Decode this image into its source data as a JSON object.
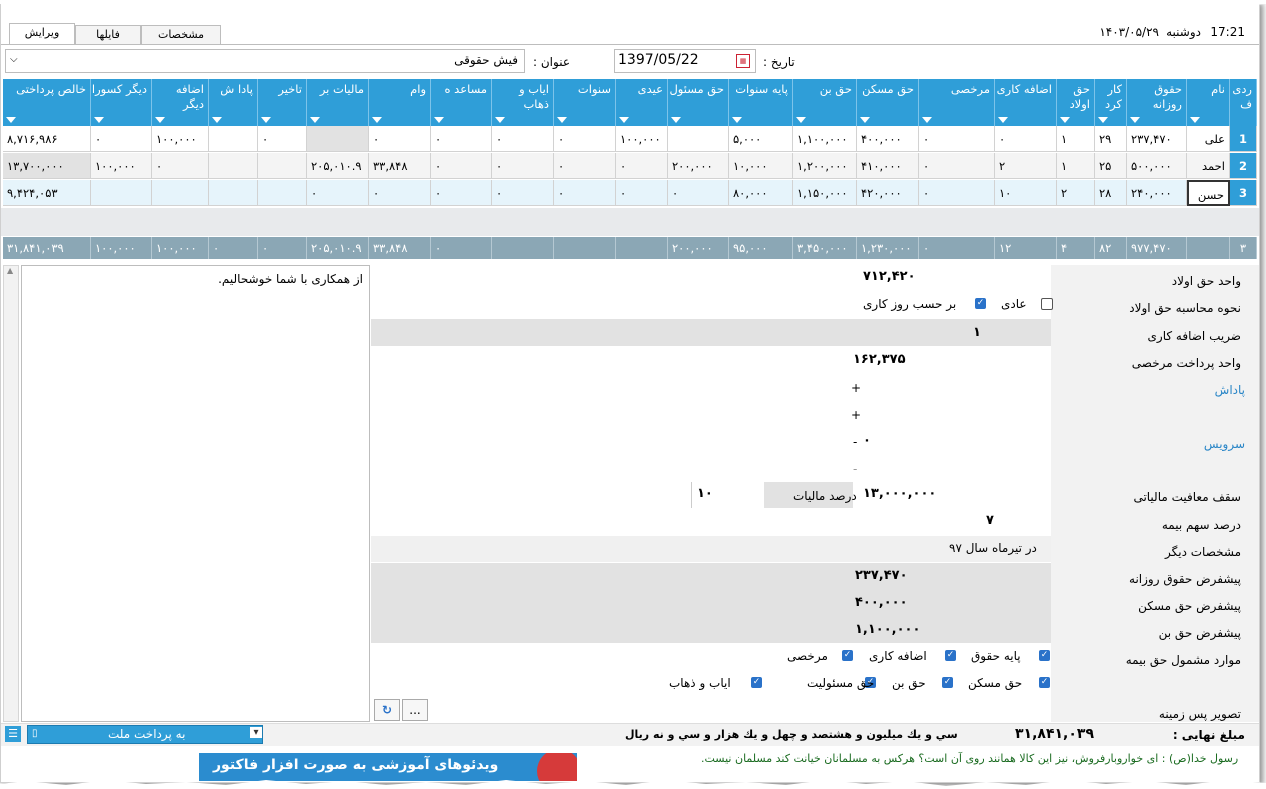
{
  "status": {
    "time": "17:21",
    "day": "دوشنبه",
    "date": "۱۴۰۳/۰۵/۲۹"
  },
  "tabs": [
    "ویرایش",
    "فایلها",
    "مشخصات"
  ],
  "form": {
    "date_label": "تاریخ :",
    "date_value": "1397/05/22",
    "title_label": "عنوان :",
    "title_value": "فیش حقوقی"
  },
  "table": {
    "columns": [
      "ردی ف",
      "نام",
      "حقوق روزانه",
      "کار کرد",
      "حق اولاد",
      "اضافه کاری",
      "مرخصی",
      "حق مسکن",
      "حق بن",
      "پایه سنوات",
      "حق مسئول",
      "عیدی",
      "سنوات",
      "ایاب و ذهاب",
      "مساعد ه",
      "وام",
      "مالیات بر",
      "تاخیر",
      "پادا ش",
      "اضافه دیگر",
      "دیگر کسورا",
      "خالص پرداختی"
    ],
    "rows": [
      [
        "1",
        "علی",
        "۲۳۷,۴۷۰",
        "۲۹",
        "۱",
        "۰",
        "۰",
        "۴۰۰,۰۰۰",
        "۱,۱۰۰,۰۰۰",
        "۵,۰۰۰",
        "",
        "۱۰۰,۰۰۰",
        "۰",
        "۰",
        "۰",
        "۰",
        "",
        "۰",
        "",
        "۱۰۰,۰۰۰",
        "۰",
        "۸,۷۱۶,۹۸۶"
      ],
      [
        "2",
        "احمد",
        "۵۰۰,۰۰۰",
        "۲۵",
        "۱",
        "۲",
        "۰",
        "۴۱۰,۰۰۰",
        "۱,۲۰۰,۰۰۰",
        "۱۰,۰۰۰",
        "۲۰۰,۰۰۰",
        "۰",
        "۰",
        "۰",
        "۰",
        "۳۳,۸۴۸",
        "۲۰۵,۰۱۰.۹",
        "",
        "",
        "۰",
        "۱۰۰,۰۰۰",
        "۱۳,۷۰۰,۰۰۰"
      ],
      [
        "3",
        "حسن",
        "۲۴۰,۰۰۰",
        "۲۸",
        "۲",
        "۱۰",
        "۰",
        "۴۲۰,۰۰۰",
        "۱,۱۵۰,۰۰۰",
        "۸۰,۰۰۰",
        "۰",
        "۰",
        "۰",
        "۰",
        "۰",
        "۰",
        "۰",
        "",
        "",
        "",
        "",
        "۹,۴۲۴,۰۵۳"
      ]
    ],
    "totals": [
      "۳",
      "",
      "۹۷۷,۴۷۰",
      "۸۲",
      "۴",
      "۱۲",
      "۰",
      "۱,۲۳۰,۰۰۰",
      "۳,۴۵۰,۰۰۰",
      "۹۵,۰۰۰",
      "۲۰۰,۰۰۰",
      "",
      "",
      "",
      "۰",
      "۳۳,۸۴۸",
      "۲۰۵,۰۱۰.۹",
      "۰",
      "۰",
      "۱۰۰,۰۰۰",
      "۱۰۰,۰۰۰",
      "۳۱,۸۴۱,۰۳۹"
    ]
  },
  "note": "از همکاری با شما خوشحالیم.",
  "props": {
    "child_unit_label": "واحد حق اولاد",
    "child_unit_value": "۷۱۲,۴۲۰",
    "child_method_label": "نحوه محاسبه حق اولاد",
    "child_method_normal": "عادی",
    "child_method_workday": "بر حسب روز کاری",
    "overtime_label": "ضریب اضافه کاری",
    "overtime_value": "۱",
    "leave_unit_label": "واحد پرداخت مرخصی",
    "leave_unit_value": "۱۶۲,۳۷۵",
    "bonus_label": "پاداش",
    "service_label": "سرویس",
    "service_value": "۰",
    "tax_ceiling_label": "سقف معافیت مالیاتی",
    "tax_ceiling_value": "۱۳,۰۰۰,۰۰۰",
    "tax_percent_label": "درصد مالیات",
    "tax_percent_value": "۱۰",
    "insurance_label": "درصد سهم بیمه",
    "insurance_value": "۷",
    "other_label": "مشخصات دیگر",
    "other_value": "در تیرماه سال ۹۷",
    "def_daily_label": "پیشفرض حقوق روزانه",
    "def_daily_value": "۲۳۷,۴۷۰",
    "def_housing_label": "پیشفرض حق مسکن",
    "def_housing_value": "۴۰۰,۰۰۰",
    "def_bon_label": "پیشفرض حق بن",
    "def_bon_value": "۱,۱۰۰,۰۰۰",
    "insured_label": "موارد مشمول حق بیمه",
    "insured_items": [
      "پایه حقوق",
      "اضافه کاری",
      "مرخصی",
      "حق مسکن",
      "حق بن",
      "حق مسئولیت",
      "ایاب و ذهاب"
    ],
    "bg_image_label": "تصویر پس زمینه",
    "browse_label": "..."
  },
  "footer": {
    "final_label": "مبلغ نهایی :",
    "final_value": "۳۱,۸۴۱,۰۳۹",
    "final_words": "سي و يك ميليون و هشتصد و چهل و يك هزار و سي و نه ريال",
    "bank_select": "به پرداخت ملت",
    "ticker": "رسول خدا(ص) : ای خواروبارفروش، نیز این کالا همانند روی آن است؟ هرکس به مسلمانان خیانت کند مسلمان نیست.",
    "banner": "ویدئوهای آموزشی به صورت افزار فاکتور"
  }
}
